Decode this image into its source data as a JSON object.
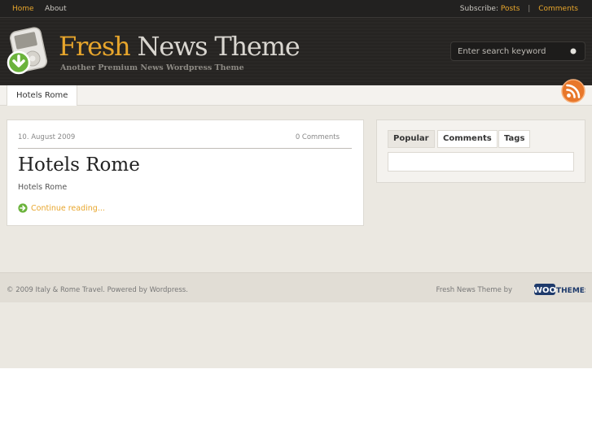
{
  "nav": {
    "home": "Home",
    "about": "About",
    "subscribe_label": "Subscribe:",
    "posts": "Posts",
    "separator": "|",
    "comments": "Comments"
  },
  "header": {
    "title_accent": "Fresh",
    "title_rest": " News Theme",
    "tagline": "Another Premium News Wordpress Theme",
    "logo_icon": "ipod-download-icon"
  },
  "search": {
    "placeholder": "Enter search keyword",
    "button_icon": "search-dot-icon"
  },
  "categories": {
    "active": "Hotels Rome",
    "rss_icon": "rss-icon"
  },
  "post": {
    "date": "10. August 2009",
    "comments": "0 Comments",
    "title": "Hotels Rome",
    "excerpt": "Hotels Rome",
    "continue": "Continue reading...",
    "continue_icon": "arrow-right-circle-icon"
  },
  "sidebar": {
    "tabs": [
      "Popular",
      "Comments",
      "Tags"
    ]
  },
  "footer": {
    "copyright": "© 2009 Italy & Rome Travel. Powered by Wordpress.",
    "credit": "Fresh News Theme by",
    "woo_logo": "WOOTHEMES"
  },
  "colors": {
    "accent": "#e8a62c",
    "header_bg": "#282624",
    "page_bg": "#ebe8e1",
    "panel_bg": "#ffffff"
  }
}
